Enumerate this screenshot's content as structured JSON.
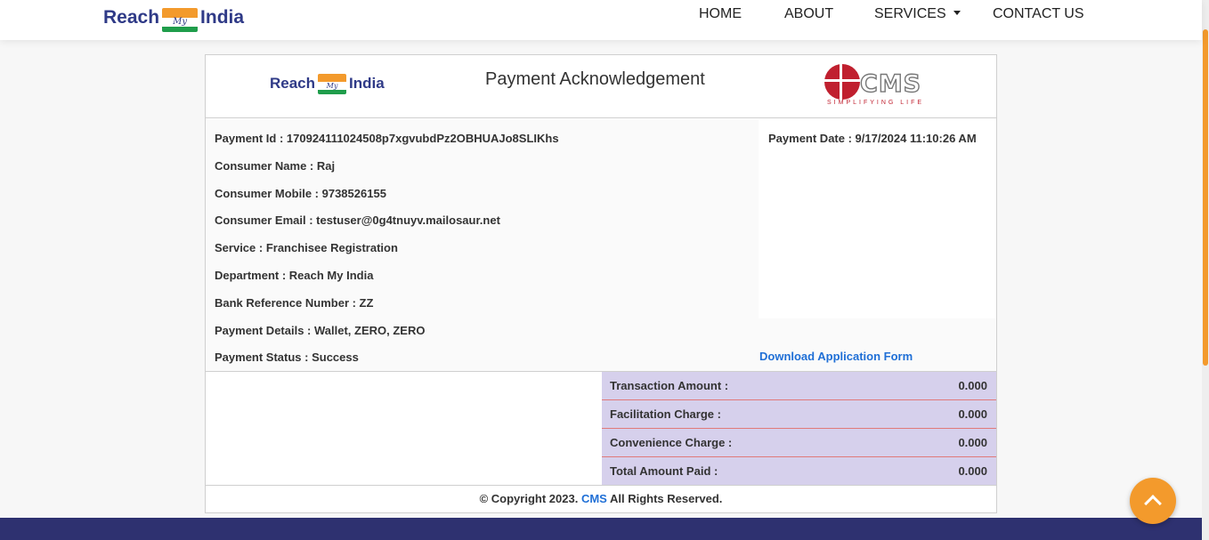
{
  "navbar": {
    "logo": {
      "word1": "Reach",
      "word2": "My",
      "word3": "India"
    },
    "links": [
      {
        "label": "HOME"
      },
      {
        "label": "ABOUT"
      },
      {
        "label": "SERVICES",
        "has_caret": true
      },
      {
        "label": "CONTACT US"
      }
    ]
  },
  "card": {
    "logo": {
      "word1": "Reach",
      "word2": "My",
      "word3": "India"
    },
    "title": "Payment Acknowledgement",
    "cms_logo": {
      "text": "CMS",
      "tagline": "SIMPLIFYING LIFE"
    },
    "payment_date": "Payment Date : 9/17/2024 11:10:26 AM",
    "details": [
      {
        "label": "Payment Id : 170924111024508p7xgvubdPz2OBHUAJo8SLIKhs"
      },
      {
        "label": "Consumer Name : Raj"
      },
      {
        "label": "Consumer Mobile : 9738526155"
      },
      {
        "label": "Consumer Email : testuser@0g4tnuyv.mailosaur.net"
      },
      {
        "label": "Service : Franchisee Registration"
      },
      {
        "label": "Department : Reach My India"
      },
      {
        "label": "Bank Reference Number : ZZ"
      },
      {
        "label": "Payment Details : Wallet, ZERO, ZERO"
      },
      {
        "label": "Payment Status : Success"
      }
    ],
    "download_link": "Download Application Form",
    "amounts": [
      {
        "label": "Transaction Amount :",
        "value": "0.000"
      },
      {
        "label": "Facilitation Charge :",
        "value": "0.000"
      },
      {
        "label": "Convenience Charge :",
        "value": "0.000"
      },
      {
        "label": "Total Amount Paid :",
        "value": "0.000"
      }
    ],
    "copyright": {
      "prefix": "© Copyright 2023.",
      "brand": "CMS",
      "suffix": "All Rights Reserved."
    }
  },
  "colors": {
    "brand_blue": "#2f3a87",
    "accent_orange": "#f39a2c",
    "link_blue": "#1f6fd6",
    "cms_red": "#c0202f",
    "footer_band": "#2e3170"
  }
}
